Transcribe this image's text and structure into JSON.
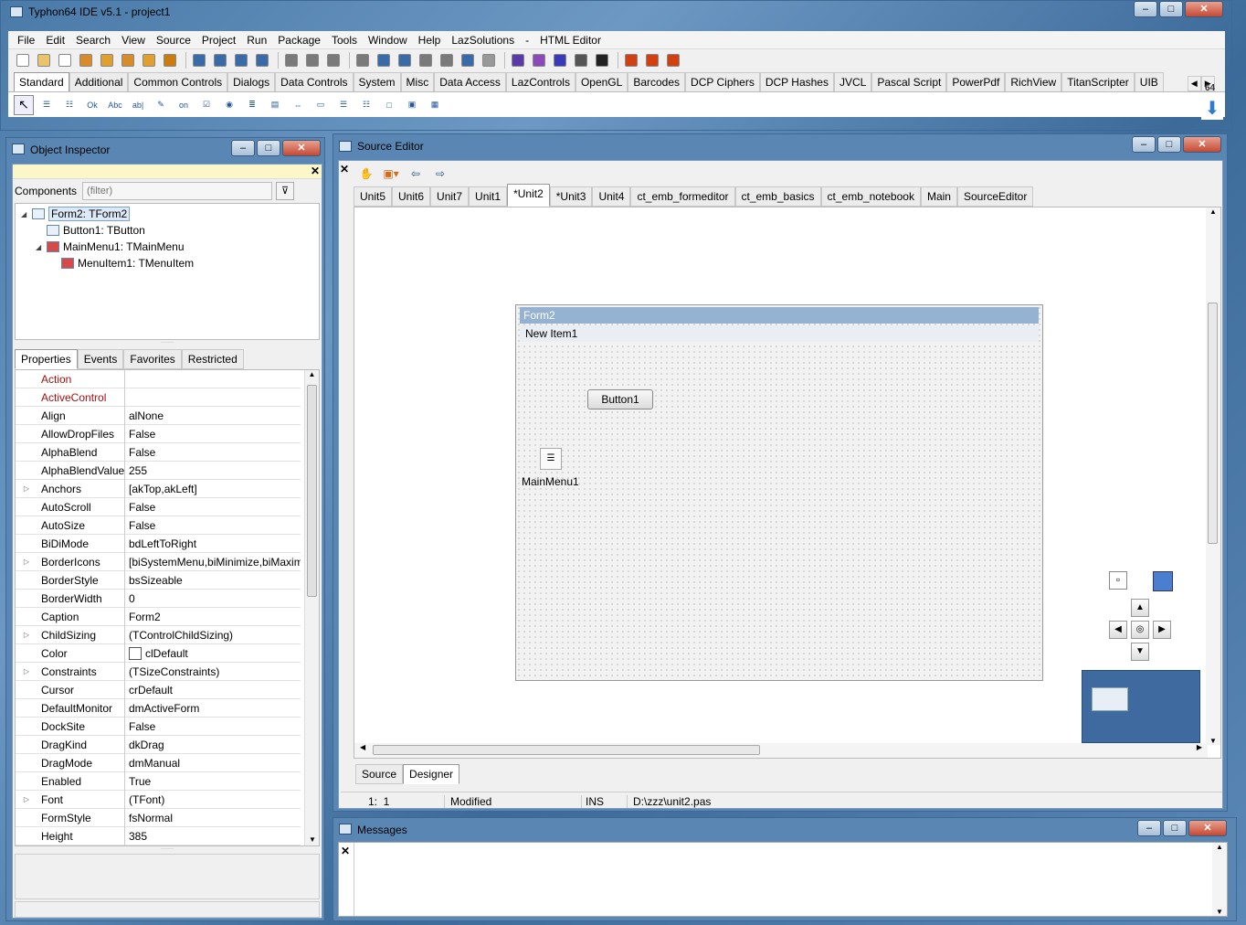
{
  "app": {
    "title": "Typhon64 IDE v5.1 - project1"
  },
  "menu": [
    "File",
    "Edit",
    "Search",
    "View",
    "Source",
    "Project",
    "Run",
    "Package",
    "Tools",
    "Window",
    "Help",
    "LazSolutions",
    "-",
    "HTML Editor"
  ],
  "palette": {
    "tabs": [
      "Standard",
      "Additional",
      "Common Controls",
      "Dialogs",
      "Data Controls",
      "System",
      "Misc",
      "Data Access",
      "LazControls",
      "OpenGL",
      "Barcodes",
      "DCP Ciphers",
      "DCP Hashes",
      "JVCL",
      "Pascal Script",
      "PowerPdf",
      "RichView",
      "TitanScripter",
      "UIB"
    ],
    "active": "Standard",
    "badge": "64",
    "icons": [
      "pointer-icon",
      "mainmenu-icon",
      "popupmenu-icon",
      "button-icon",
      "label-icon",
      "edit-icon",
      "memo-icon",
      "togglebox-icon",
      "checkbox-icon",
      "radiobutton-icon",
      "listbox-icon",
      "combobox-icon",
      "scrollbar-icon",
      "groupbox-icon",
      "radiogroup-icon",
      "checkgroup-icon",
      "panel-icon",
      "frame-icon",
      "actionlist-icon"
    ],
    "icon_texts": {
      "button": "Ok",
      "label": "Abc",
      "edit": "ab|",
      "togglebox": "on"
    }
  },
  "object_inspector": {
    "title": "Object Inspector",
    "components_label": "Components",
    "filter_placeholder": "(filter)",
    "tree": [
      {
        "label": "Form2: TForm2",
        "level": 0
      },
      {
        "label": "Button1: TButton",
        "level": 1
      },
      {
        "label": "MainMenu1: TMainMenu",
        "level": 1
      },
      {
        "label": "MenuItem1: TMenuItem",
        "level": 2
      }
    ],
    "tabs": [
      "Properties",
      "Events",
      "Favorites",
      "Restricted"
    ],
    "properties": [
      {
        "name": "Action",
        "value": "",
        "red": true
      },
      {
        "name": "ActiveControl",
        "value": "",
        "red": true
      },
      {
        "name": "Align",
        "value": "alNone"
      },
      {
        "name": "AllowDropFiles",
        "value": "False"
      },
      {
        "name": "AlphaBlend",
        "value": "False"
      },
      {
        "name": "AlphaBlendValue",
        "value": "255"
      },
      {
        "name": "Anchors",
        "value": "[akTop,akLeft]",
        "expand": true
      },
      {
        "name": "AutoScroll",
        "value": "False"
      },
      {
        "name": "AutoSize",
        "value": "False"
      },
      {
        "name": "BiDiMode",
        "value": "bdLeftToRight"
      },
      {
        "name": "BorderIcons",
        "value": "[biSystemMenu,biMinimize,biMaxim",
        "expand": true
      },
      {
        "name": "BorderStyle",
        "value": "bsSizeable"
      },
      {
        "name": "BorderWidth",
        "value": "0"
      },
      {
        "name": "Caption",
        "value": "Form2"
      },
      {
        "name": "ChildSizing",
        "value": "(TControlChildSizing)",
        "expand": true
      },
      {
        "name": "Color",
        "value": "clDefault",
        "swatch": true
      },
      {
        "name": "Constraints",
        "value": "(TSizeConstraints)",
        "expand": true
      },
      {
        "name": "Cursor",
        "value": "crDefault"
      },
      {
        "name": "DefaultMonitor",
        "value": "dmActiveForm"
      },
      {
        "name": "DockSite",
        "value": "False"
      },
      {
        "name": "DragKind",
        "value": "dkDrag"
      },
      {
        "name": "DragMode",
        "value": "dmManual"
      },
      {
        "name": "Enabled",
        "value": "True"
      },
      {
        "name": "Font",
        "value": "(TFont)",
        "expand": true
      },
      {
        "name": "FormStyle",
        "value": "fsNormal"
      },
      {
        "name": "Height",
        "value": "385"
      }
    ]
  },
  "source_editor": {
    "title": "Source Editor",
    "tabs": [
      "Unit5",
      "Unit6",
      "Unit7",
      "Unit1",
      "*Unit2",
      "*Unit3",
      "Unit4",
      "ct_emb_formeditor",
      "ct_emb_basics",
      "ct_emb_notebook",
      "Main",
      "SourceEditor"
    ],
    "active_tab": "*Unit2",
    "form": {
      "title": "Form2",
      "menu_item": "New Item1",
      "button": "Button1",
      "component": "MainMenu1"
    },
    "bottom_tabs": [
      "Source",
      "Designer"
    ],
    "active_bottom": "Designer",
    "status": {
      "pos": "1:  1",
      "modified": "Modified",
      "mode": "INS",
      "file": "D:\\zzz\\unit2.pas"
    }
  },
  "messages": {
    "title": "Messages"
  }
}
